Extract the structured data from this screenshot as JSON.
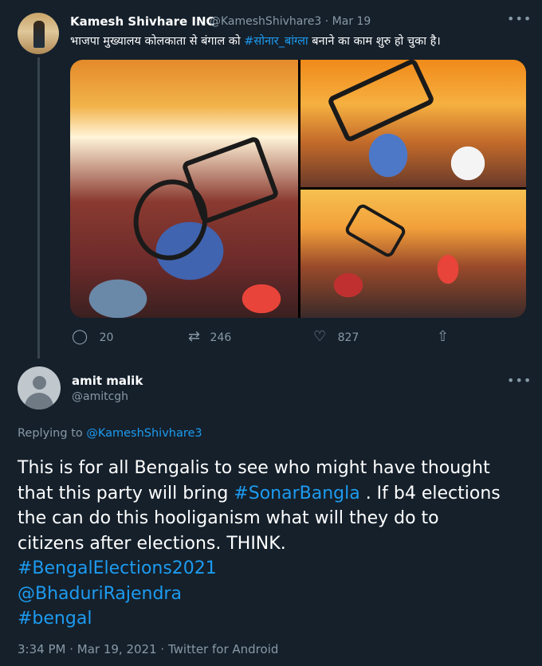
{
  "parent_tweet": {
    "author_name": "Kamesh Shivhare INC",
    "author_handle": "@KameshShivhare3",
    "separator": "·",
    "date": "Mar 19",
    "more_icon": "more-horizontal-icon",
    "text_before": "भाजपा मुख्यालय कोलकाता से बंगाल को ",
    "hashtag": "#सोनार_बांग्ला",
    "text_after": " बनाने का काम शुरु हो चुका है।",
    "actions": {
      "reply_count": "20",
      "retweet_count": "246",
      "like_count": "827"
    }
  },
  "reply_tweet": {
    "author_name": "amit malik",
    "author_handle": "@amitcgh",
    "replying_label": "Replying to ",
    "replying_to": "@KameshShivhare3",
    "line1": "This is for all Bengalis to see who might have thought",
    "line2_a": "that this party will bring ",
    "line2_tag": "#SonarBangla",
    "line2_b": " . If b4 elections",
    "line3": "the can do this hooliganism  what will they do to",
    "line4": "citizens after elections.  THINK.",
    "tag1": "#BengalElections2021",
    "mention1": "@BhaduriRajendra",
    "tag2": "#bengal",
    "time": "3:34 PM",
    "meta_sep": " · ",
    "full_date": "Mar 19, 2021",
    "source": "Twitter for Android"
  },
  "colors": {
    "background": "#15202b",
    "text": "#ffffff",
    "muted": "#8899a6",
    "link": "#1d9bf0",
    "thread_line": "#38444d"
  }
}
